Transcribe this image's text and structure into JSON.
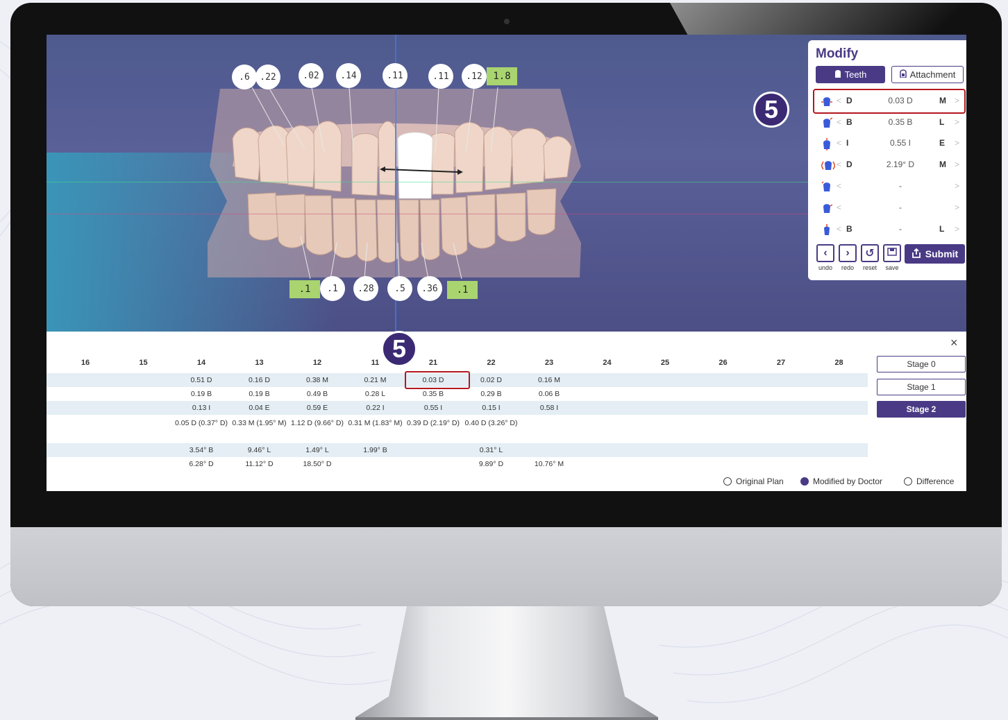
{
  "viewport": {
    "upper_labels": [
      ".6",
      ".22",
      ".02",
      ".14",
      ".11",
      ".11",
      ".12"
    ],
    "upper_tag": "1.8",
    "lower_tag_left": ".1",
    "lower_labels": [
      ".1",
      ".28",
      ".5",
      ".36"
    ],
    "lower_tag_right": ".1"
  },
  "modify": {
    "title": "Modify",
    "tabs": {
      "teeth": "Teeth",
      "attachment": "Attachment"
    },
    "rows": [
      {
        "icon": "tooth-mesial-distal-icon",
        "left_dir": "D",
        "value": "0.03 D",
        "right_dir": "M"
      },
      {
        "icon": "tooth-buccal-lingual-icon",
        "left_dir": "B",
        "value": "0.35 B",
        "right_dir": "L"
      },
      {
        "icon": "tooth-intrusion-extrusion-icon",
        "left_dir": "I",
        "value": "0.55 I",
        "right_dir": "E"
      },
      {
        "icon": "tooth-rotation-icon",
        "left_dir": "D",
        "value": "2.19° D",
        "right_dir": "M"
      },
      {
        "icon": "tooth-angulation-icon",
        "left_dir": "",
        "value": "-",
        "right_dir": ""
      },
      {
        "icon": "tooth-inclination-icon",
        "left_dir": "",
        "value": "-",
        "right_dir": ""
      },
      {
        "icon": "tooth-torque-icon",
        "left_dir": "B",
        "value": "-",
        "right_dir": "L"
      }
    ],
    "actions": {
      "undo": "undo",
      "redo": "redo",
      "reset": "reset",
      "save": "save",
      "submit": "Submit"
    }
  },
  "step_marker": "5",
  "table": {
    "columns": [
      "16",
      "15",
      "14",
      "13",
      "12",
      "11",
      "21",
      "22",
      "23",
      "24",
      "25",
      "26",
      "27",
      "28"
    ],
    "rows": [
      [
        "",
        "",
        "0.51 D",
        "0.16 D",
        "0.38 M",
        "0.21 M",
        "0.03 D",
        "0.02 D",
        "0.16 M",
        "",
        "",
        "",
        "",
        ""
      ],
      [
        "",
        "",
        "0.19 B",
        "0.19 B",
        "0.49 B",
        "0.28 L",
        "0.35 B",
        "0.29 B",
        "0.06 B",
        "",
        "",
        "",
        "",
        ""
      ],
      [
        "",
        "",
        "0.13 I",
        "0.04 E",
        "0.59 E",
        "0.22 I",
        "0.55 I",
        "0.15 I",
        "0.58 I",
        "",
        "",
        "",
        "",
        ""
      ],
      [
        "",
        "",
        "0.05 D (0.37° D)",
        "0.33 M (1.95° M)",
        "1.12 D (9.66° D)",
        "0.31 M (1.83° M)",
        "0.39 D (2.19° D)",
        "0.40 D (3.26° D)",
        "",
        "",
        "",
        "",
        "",
        ""
      ],
      [
        "",
        "",
        "3.54° B",
        "9.46° L",
        "1.49° L",
        "1.99° B",
        "",
        "0.31° L",
        "",
        "",
        "",
        "",
        "",
        ""
      ],
      [
        "",
        "",
        "6.28° D",
        "11.12° D",
        "18.50° D",
        "",
        "",
        "9.89° D",
        "10.76° M",
        "",
        "",
        "",
        "",
        ""
      ]
    ],
    "close": "×"
  },
  "stages": [
    "Stage 0",
    "Stage 1",
    "Stage 2"
  ],
  "active_stage": "Stage 2",
  "legend": {
    "original": "Original Plan",
    "modified": "Modified by Doctor",
    "difference": "Difference",
    "selected": "Modified by Doctor"
  },
  "colors": {
    "accent": "#4a3a86",
    "highlight": "#b3161f",
    "tag_green": "#a9d46f"
  }
}
